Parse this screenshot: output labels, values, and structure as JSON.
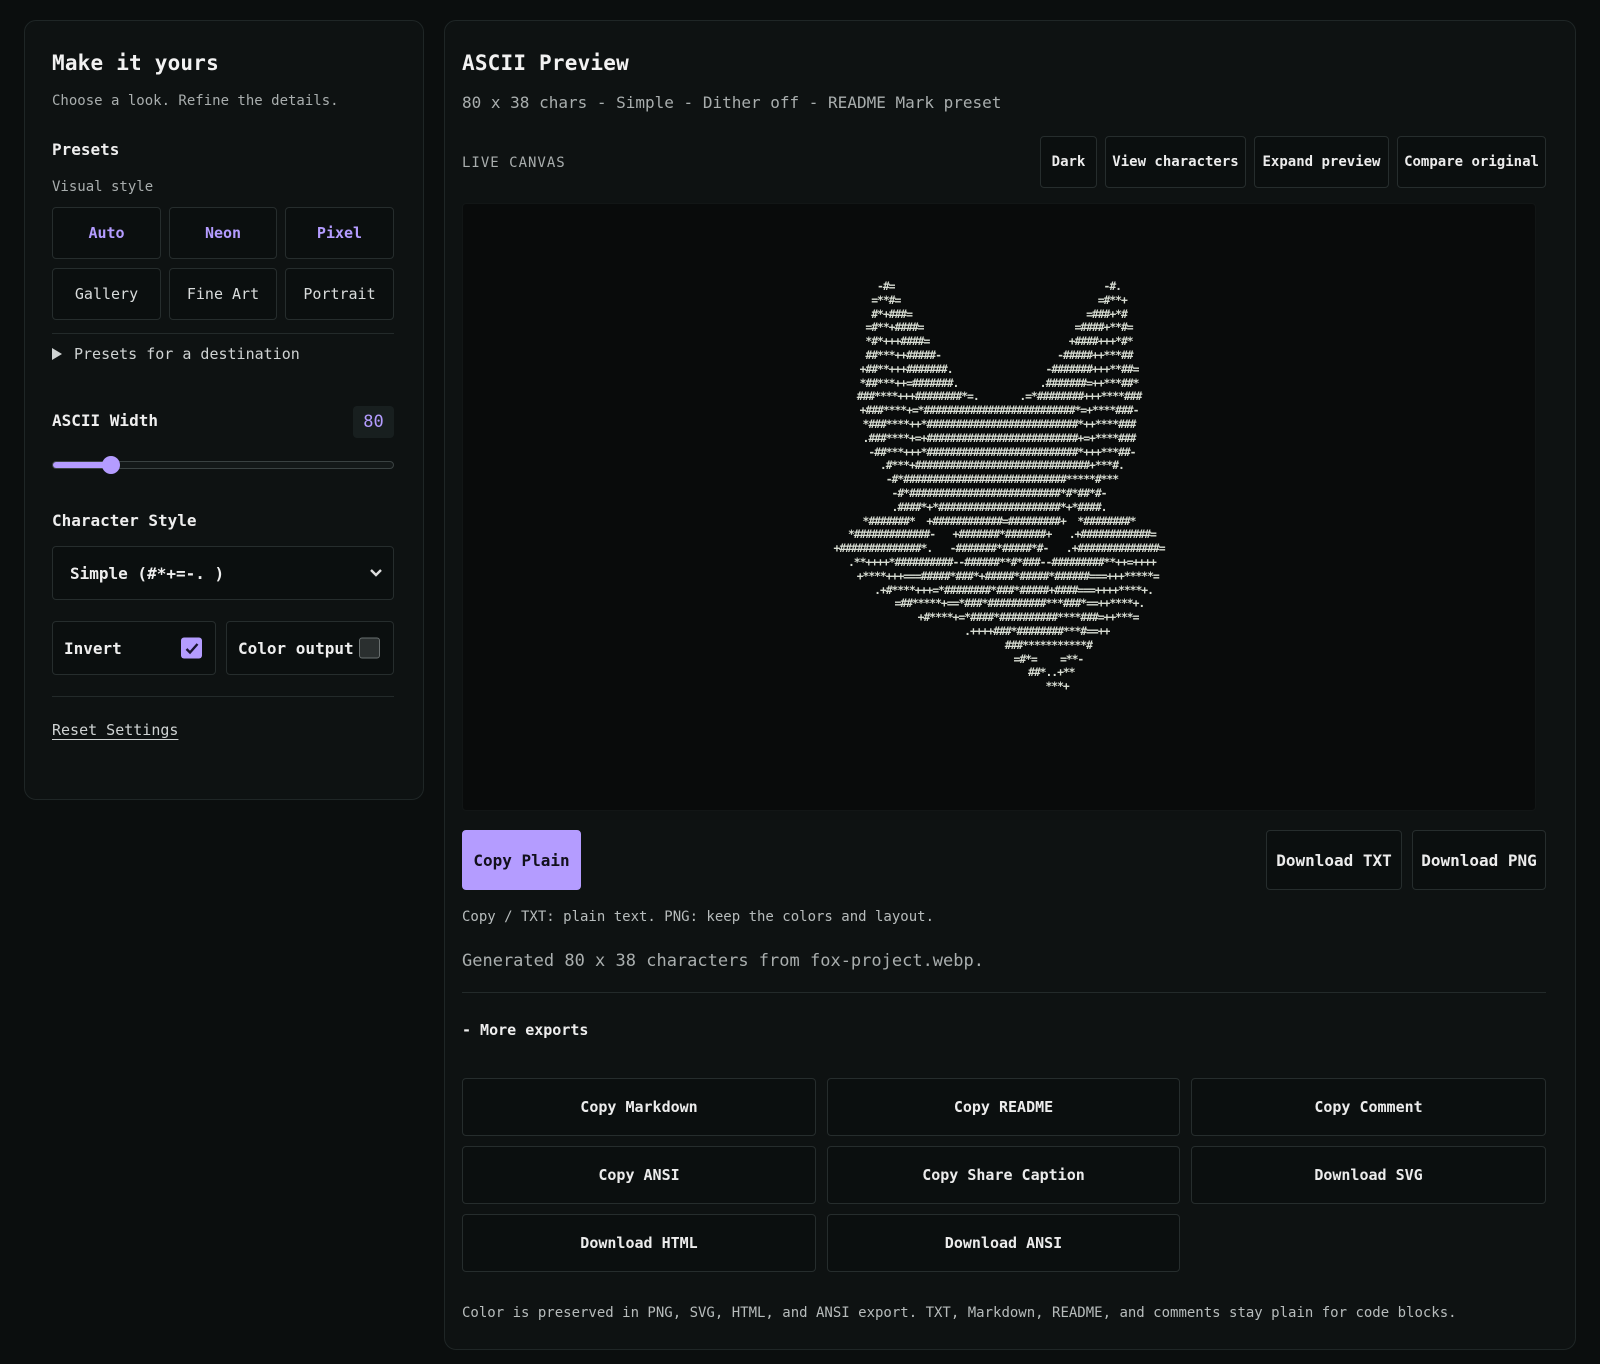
{
  "left": {
    "title": "Make it yours",
    "subtitle": "Choose a look. Refine the details.",
    "presets_heading": "Presets",
    "visual_style_label": "Visual style",
    "styles": [
      "Auto",
      "Neon",
      "Pixel",
      "Gallery",
      "Fine Art",
      "Portrait"
    ],
    "destination_toggle": "Presets for a destination",
    "width_label": "ASCII Width",
    "width_value": "80",
    "width_fraction": 0.17,
    "char_style_label": "Character Style",
    "char_style_value": "Simple (#*+=-. )",
    "invert_label": "Invert",
    "invert_checked": true,
    "color_output_label": "Color output",
    "color_output_checked": false,
    "reset_label": "Reset Settings"
  },
  "right": {
    "title": "ASCII Preview",
    "meta": "80 x 38 chars - Simple - Dither off - README Mark preset",
    "live_label": "LIVE CANVAS",
    "toolbar": [
      "Dark",
      "View characters",
      "Expand preview",
      "Compare original"
    ],
    "ascii_lines": [
      "   -#=                                    -#.   ",
      "  =**#=                                  =#**+  ",
      "  #*+###=                              =###+*#  ",
      " =#**+####=                          =####+**#= ",
      " *#*+++####=                        +####+++*#* ",
      " ##***++#####-                    -#####++***## ",
      "+##**+++#######.                -#######+++**##=",
      "*##***++=#######.              .#######=++***##*",
      "###****+++########*=.       .=*########+++****###",
      "+###****+=*##########################*=+****###-",
      "*###****++*##########################*++****###",
      ".###****+=+##########################+=+****###",
      " -##***+++*##########################*+++***##-",
      "  .#***+##############################+***#. ",
      "   -#*############################*****#***  ",
      "    -#*##########################*#*##*#-    ",
      "     .####*+*#####################*+*####.     ",
      "  *#######*  +############=#########+  *########*  ",
      " *#############-   +#######*#######+   .+############=",
      "+##############*.   -#######*#####*#-   .+##############=",
      " .**++++*##########--######**#*###--#########**++=++++",
      "   +****+++===#####*###*+#####*#####*######===+++*****=",
      "     .+#****+++=*########*###*#####+####===++++****+.",
      "       =##*****+==*###*##########***###*==++****+.",
      "          +#****+=*####*##########****###=++***=",
      "             .++++###*########***#==++",
      "                 ###***********#",
      "                 =#*=    =**-",
      "                  ##*..+**",
      "                    ***+"
    ],
    "copy_plain": "Copy Plain",
    "download_txt": "Download TXT",
    "download_png": "Download PNG",
    "hint": "Copy / TXT: plain text. PNG: keep the colors and layout.",
    "generated": "Generated 80 x 38 characters from fox-project.webp.",
    "more_exports": "- More exports",
    "exports": [
      "Copy Markdown",
      "Copy README",
      "Copy Comment",
      "Copy ANSI",
      "Copy Share Caption",
      "Download SVG",
      "Download HTML",
      "Download ANSI"
    ],
    "footnote": "Color is preserved in PNG, SVG, HTML, and ANSI export. TXT, Markdown, README, and comments stay plain for code blocks."
  },
  "colors": {
    "accent": "#b49cff",
    "background": "#0b0e0e",
    "panel": "#0e1212"
  }
}
